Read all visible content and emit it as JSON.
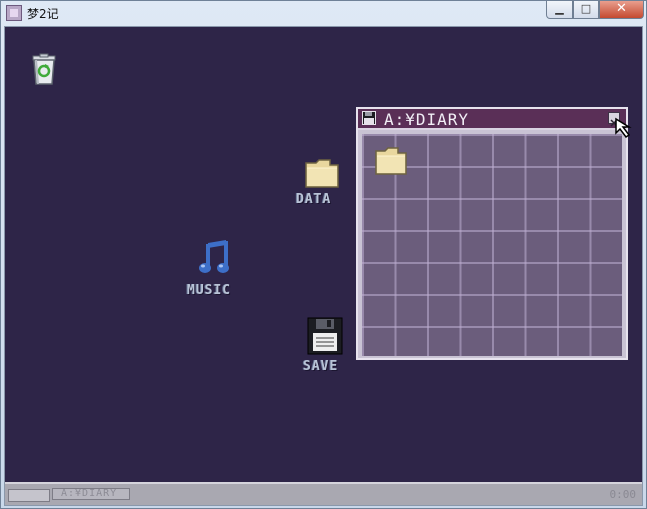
{
  "window": {
    "title": "梦2记",
    "controls": {
      "minimize": "▁",
      "maximize": "□",
      "close": "✕"
    }
  },
  "desktop": {
    "icons": [
      {
        "id": "trash",
        "label": "",
        "icon": "recycle-bin-icon"
      },
      {
        "id": "data",
        "label": "DATA",
        "icon": "folder-icon"
      },
      {
        "id": "music",
        "label": "MUSIC",
        "icon": "music-note-icon"
      },
      {
        "id": "save",
        "label": "SAVE",
        "icon": "floppy-disk-icon"
      }
    ]
  },
  "diary_window": {
    "title": "A:¥DIARY",
    "contents": [
      {
        "type": "folder",
        "icon": "folder-icon"
      }
    ]
  },
  "taskbar": {
    "task_label": "A:¥DIARY",
    "clock": "0:00"
  },
  "colors": {
    "desktop_bg": "#2e2548",
    "window_title_bg": "#5a2f57",
    "grid_bg": "#6b5d7c",
    "label_text": "#b9c3d6"
  }
}
